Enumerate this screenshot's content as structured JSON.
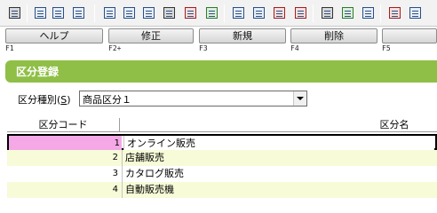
{
  "toolbar": {
    "icons": [
      {
        "name": "grid-view-icon"
      },
      {
        "name": "save-icon"
      },
      {
        "name": "save-as-icon"
      },
      {
        "name": "close-doc-icon"
      },
      {
        "name": "copy-doc-icon"
      },
      {
        "name": "form-icon"
      },
      {
        "name": "form-alt-icon"
      },
      {
        "name": "print-icon"
      },
      {
        "name": "calculator-icon"
      },
      {
        "name": "yen-icon"
      },
      {
        "name": "list-icon"
      },
      {
        "name": "window-icon"
      },
      {
        "name": "yen-red-icon"
      },
      {
        "name": "yen-circle-icon"
      },
      {
        "name": "home-icon"
      },
      {
        "name": "settings-icon"
      },
      {
        "name": "table-icon"
      },
      {
        "name": "report-icon"
      },
      {
        "name": "report-alt-icon"
      }
    ]
  },
  "function_keys": [
    {
      "label": "ヘルプ",
      "key": "F1"
    },
    {
      "label": "修正",
      "key": "F2+"
    },
    {
      "label": "新規",
      "key": "F3"
    },
    {
      "label": "削除",
      "key": "F4"
    },
    {
      "label": "",
      "key": "F5"
    }
  ],
  "section": {
    "title": "区分登録"
  },
  "type_selector": {
    "label_prefix": "区分種別(",
    "label_mnemonic": "S",
    "label_suffix": ")",
    "value": "商品区分１"
  },
  "grid": {
    "headers": {
      "code": "区分コード",
      "name": "区分名"
    },
    "rows": [
      {
        "code": "1",
        "name": "オンライン販売"
      },
      {
        "code": "2",
        "name": "店舗販売"
      },
      {
        "code": "3",
        "name": "カタログ販売"
      },
      {
        "code": "4",
        "name": "自動販売機"
      }
    ]
  },
  "colors": {
    "section": "#8fbf47",
    "selected_cell": "#f4a8e6",
    "alt_row": "#f7fbd8"
  }
}
